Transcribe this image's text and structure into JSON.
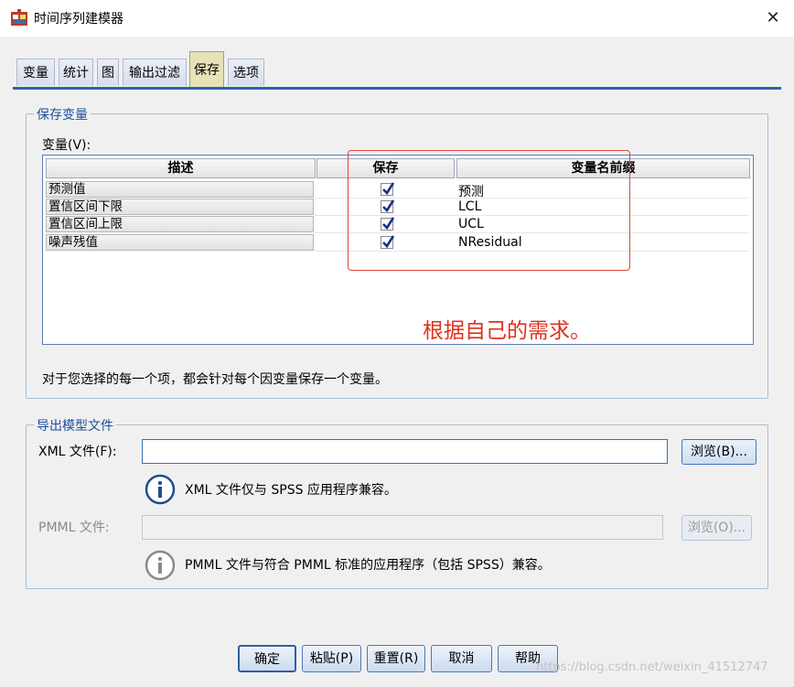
{
  "window": {
    "title": "时间序列建模器",
    "close_glyph": "✕"
  },
  "tabs": [
    {
      "label": "变量"
    },
    {
      "label": "统计"
    },
    {
      "label": "图"
    },
    {
      "label": "输出过滤"
    },
    {
      "label": "保存"
    },
    {
      "label": "选项"
    }
  ],
  "active_tab": "保存",
  "save_group": {
    "title": "保存变量",
    "variables_label": "变量(V):",
    "columns": [
      "描述",
      "保存",
      "变量名前缀"
    ],
    "rows": [
      {
        "description": "预测值",
        "save": true,
        "prefix": "预测"
      },
      {
        "description": "置信区间下限",
        "save": true,
        "prefix": "LCL"
      },
      {
        "description": "置信区间上限",
        "save": true,
        "prefix": "UCL"
      },
      {
        "description": "噪声残值",
        "save": true,
        "prefix": "NResidual"
      }
    ],
    "note": "对于您选择的每一个项，都会针对每个因变量保存一个变量。"
  },
  "annotation": {
    "text": "根据自己的需求。",
    "color": "#e0301e"
  },
  "export_group": {
    "title": "导出模型文件",
    "xml": {
      "label": "XML 文件(F):",
      "value": "",
      "browse": "浏览(B)...",
      "info": "XML 文件仅与 SPSS 应用程序兼容。"
    },
    "pmml": {
      "label": "PMML 文件:",
      "value": "",
      "browse": "浏览(O)...",
      "info": "PMML 文件与符合 PMML 标准的应用程序（包括 SPSS）兼容。"
    }
  },
  "buttons": {
    "ok": "确定",
    "paste": "粘贴(P)",
    "reset": "重置(R)",
    "cancel": "取消",
    "help": "帮助"
  },
  "watermark": "https://blog.csdn.net/weixin_41512747",
  "colors": {
    "accent": "#2a63b0",
    "active_tab": "#e7e2b7",
    "group_title": "#1c4f9c"
  }
}
